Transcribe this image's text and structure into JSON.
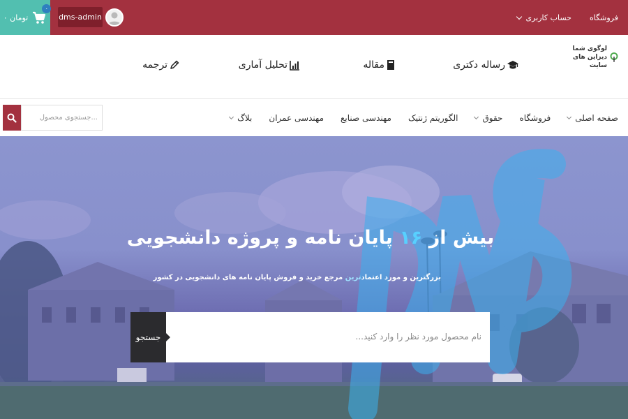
{
  "topbar": {
    "cart_text": "۰ تومان",
    "cart_count": "۰",
    "username": "dms-admin",
    "links": [
      {
        "label": "فروشگاه",
        "dropdown": false
      },
      {
        "label": "حساب کاربری",
        "dropdown": true
      }
    ]
  },
  "header": {
    "logo_line1": "لوگوی شما",
    "logo_line2": "دیزاین های سایت",
    "services": [
      {
        "label": "رساله دکتری",
        "icon": "graduation-cap-icon"
      },
      {
        "label": "مقاله",
        "icon": "book-icon"
      },
      {
        "label": "تحلیل آماری",
        "icon": "chart-icon"
      },
      {
        "label": "ترجمه",
        "icon": "pencil-icon"
      }
    ]
  },
  "nav": {
    "items": [
      {
        "label": "صفحه اصلی",
        "dropdown": true
      },
      {
        "label": "فروشگاه",
        "dropdown": false
      },
      {
        "label": "حقوق",
        "dropdown": true
      },
      {
        "label": "الگوریتم ژنتیک",
        "dropdown": false
      },
      {
        "label": "مهندسی صنایع",
        "dropdown": false
      },
      {
        "label": "مهندسی عمران",
        "dropdown": false
      },
      {
        "label": "بلاگ",
        "dropdown": true
      }
    ],
    "search_placeholder": "جستجوی محصول..."
  },
  "hero": {
    "title_before": "بیش از",
    "title_number": "۱۶",
    "title_after": "پایان نامه و پروژه دانشجویی",
    "subtitle_before": "بزرگترین و مورد اعتماد",
    "subtitle_accent": "ترین",
    "subtitle_after": "مرجع خرید و فروش پایان نامه های دانشجویی در کشور",
    "search_placeholder": "نام محصول مورد نظر را وارد کنید...",
    "search_button": "جستجو",
    "watermark": "DMS"
  },
  "colors": {
    "topbar": "#a3313f",
    "cart": "#52bfb0",
    "accent": "#58d0ff"
  }
}
